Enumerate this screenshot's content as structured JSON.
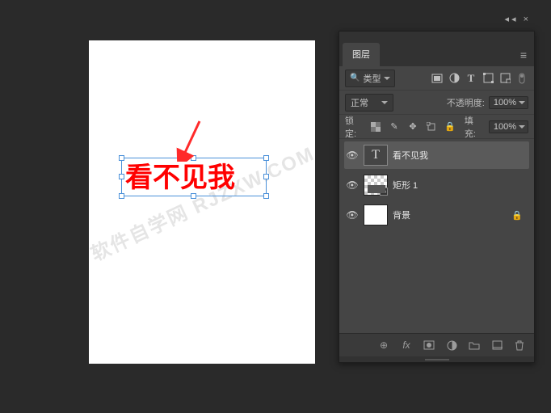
{
  "panel": {
    "title": "图层",
    "filter_label": "类型",
    "blend_mode": "正常",
    "opacity_label": "不透明度:",
    "opacity_value": "100%",
    "lock_label": "锁定:",
    "fill_label": "填充:",
    "fill_value": "100%"
  },
  "layers": [
    {
      "name": "看不见我",
      "type": "text",
      "visible": true,
      "selected": true,
      "locked": false
    },
    {
      "name": "矩形 1",
      "type": "shape",
      "visible": true,
      "selected": false,
      "locked": false
    },
    {
      "name": "背景",
      "type": "background",
      "visible": true,
      "selected": false,
      "locked": true
    }
  ],
  "canvas": {
    "text_content": "看不见我",
    "watermark": "软件自学网  RJZXW.COM"
  },
  "colors": {
    "text_red": "#ff0000",
    "selection_blue": "#4a90d9",
    "arrow_red": "#ff2a2a",
    "panel_bg": "#454545"
  }
}
